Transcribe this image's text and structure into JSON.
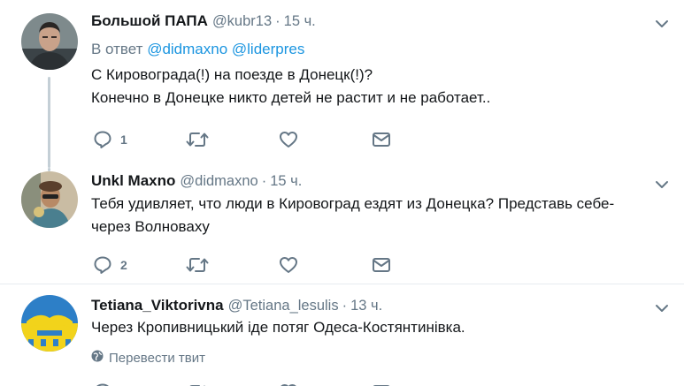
{
  "tweets": [
    {
      "name": "Большой ПАПА",
      "handle": "@kubr13",
      "separator": "·",
      "time": "15 ч.",
      "reply_prefix": "В ответ",
      "reply_mentions": [
        "@didmaxno",
        "@liderpres"
      ],
      "lines": [
        "С Кировограда(!) на поезде в Донецк(!)?",
        "Конечно в Донецке никто детей не растит и не работает.."
      ],
      "reply_count": "1"
    },
    {
      "name": "Unkl Maxno",
      "handle": "@didmaxno",
      "separator": "·",
      "time": "15 ч.",
      "lines": [
        "Тебя удивляет, что люди в Кировоград ездят из Донецка? Представь себе-",
        "через Волноваху"
      ],
      "reply_count": "2"
    },
    {
      "name": "Tetiana_Viktorivna",
      "handle": "@Tetiana_lesulis",
      "separator": "·",
      "time": "13 ч.",
      "lines": [
        "Через Кропивницький іде потяг Одеса-Костянтинівка."
      ],
      "translate_label": "Перевести твит"
    }
  ],
  "icons": {
    "caret": "chevron-down-icon",
    "reply": "reply-icon",
    "retweet": "retweet-icon",
    "like": "heart-icon",
    "dm": "envelope-icon",
    "translate": "globe-icon"
  },
  "colors": {
    "text": "#14171a",
    "secondary": "#657786",
    "link": "#1b95e0",
    "thread_line": "#c4cfd6",
    "divider": "#e6ecf0"
  }
}
